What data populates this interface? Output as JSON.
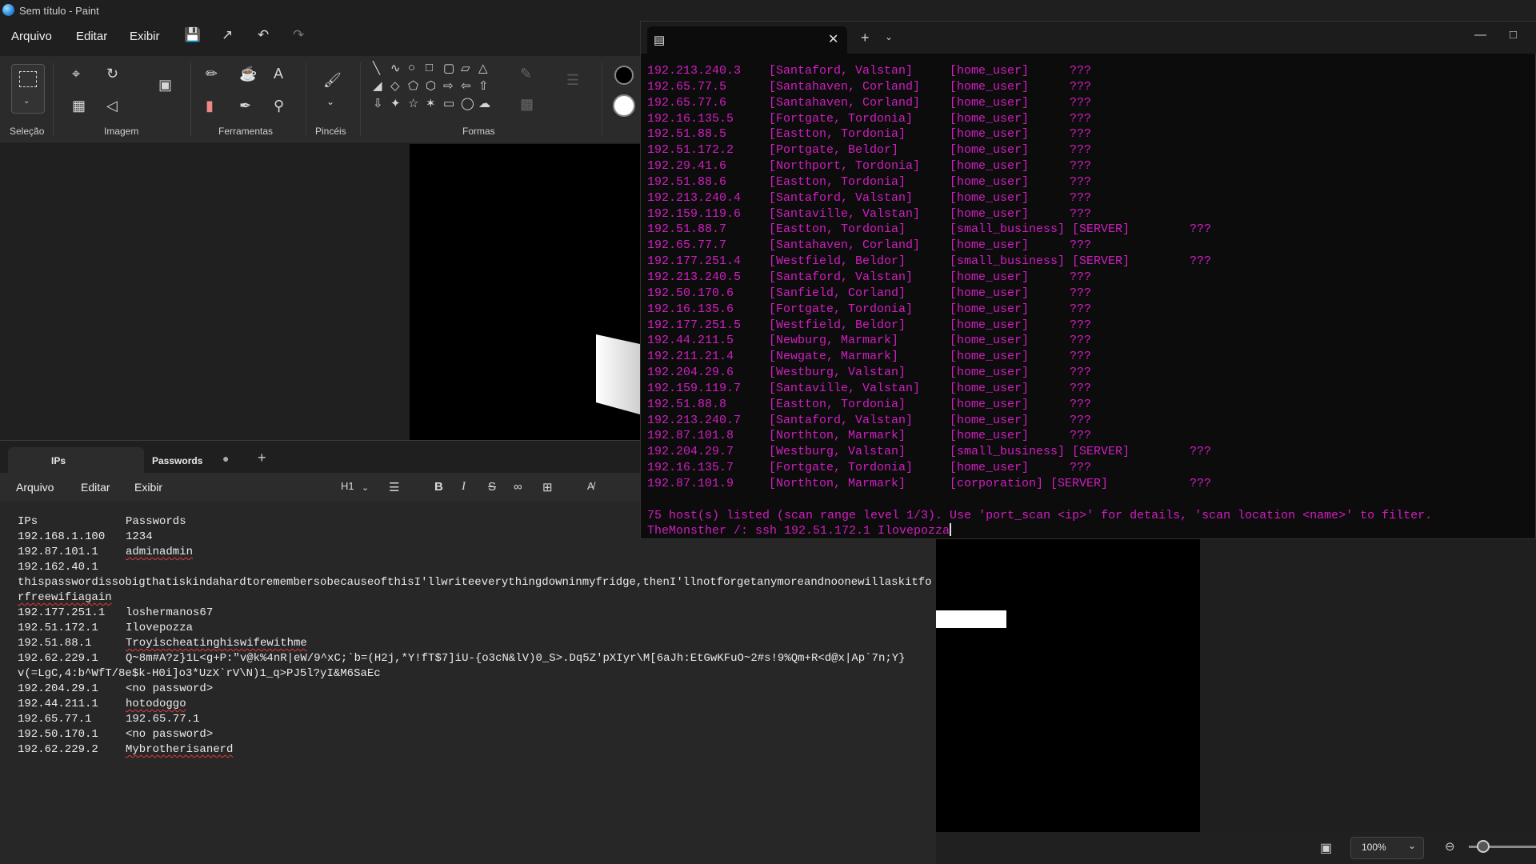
{
  "paint": {
    "window_title": "Sem título - Paint",
    "menu": [
      "Arquivo",
      "Editar",
      "Exibir"
    ],
    "groups": {
      "selection": "Seleção",
      "image": "Imagem",
      "tools": "Ferramentas",
      "brushes": "Pincéis",
      "shapes": "Formas"
    },
    "zoom": "100%"
  },
  "notepad": {
    "tabs": [
      "IPs",
      "Passwords"
    ],
    "menu": [
      "Arquivo",
      "Editar",
      "Exibir"
    ],
    "heading_control": "H1",
    "lines": [
      {
        "ip": "IPs",
        "pw": "Passwords"
      },
      {
        "ip": "192.168.1.100",
        "pw": "1234"
      },
      {
        "ip": "192.87.101.1",
        "pw": "adminadmin"
      },
      {
        "ip": "192.162.40.1",
        "pw": ""
      },
      {
        "ip": "",
        "pw": "thispasswordissobigthatiskindahardtoremembersobecauseofthisI'llwriteeverythingdowninmyfridge,thenI'llnotforgetanymoreandnoonewillaskitfo"
      },
      {
        "ip": "",
        "pw": "rfreewifiagain"
      },
      {
        "ip": "192.177.251.1",
        "pw": "loshermanos67"
      },
      {
        "ip": "192.51.172.1",
        "pw": "Ilovepozza"
      },
      {
        "ip": "192.51.88.1",
        "pw": "Troyischeatinghiswifewithme"
      },
      {
        "ip": "192.62.229.1",
        "pw": "Q~8m#A?z}1L<g+P:\"v@k%4nR|eW/9^xC;`b=(H2j,*Y!fT$7]iU-{o3cN&lV)0_S>.Dq5Z'pXIyr\\M[6aJh:EtGwKFuO~2#s!9%Qm+R<d@x|Ap`7n;Y}"
      },
      {
        "ip": "",
        "pw": "v(=LgC,4:b^WfT/8e$k-H0i]o3*UzX`rV\\N)1_q>PJ5l?yI&M6SaEc"
      },
      {
        "ip": "192.204.29.1",
        "pw": "<no password>"
      },
      {
        "ip": "192.44.211.1",
        "pw": "hotodoggo"
      },
      {
        "ip": "192.65.77.1",
        "pw": "192.65.77.1"
      },
      {
        "ip": "192.50.170.1",
        "pw": "<no password>"
      },
      {
        "ip": "192.62.229.2",
        "pw": "Mybrotherisanerd"
      }
    ]
  },
  "terminal": {
    "rows": [
      {
        "ip": "192.213.240.3",
        "loc": "[Santaford, Valstan]",
        "type": "[home_user]",
        "extra": "???"
      },
      {
        "ip": "192.65.77.5",
        "loc": "[Santahaven, Corland]",
        "type": "[home_user]",
        "extra": "???"
      },
      {
        "ip": "192.65.77.6",
        "loc": "[Santahaven, Corland]",
        "type": "[home_user]",
        "extra": "???"
      },
      {
        "ip": "192.16.135.5",
        "loc": "[Fortgate, Tordonia]",
        "type": "[home_user]",
        "extra": "???"
      },
      {
        "ip": "192.51.88.5",
        "loc": "[Eastton, Tordonia]",
        "type": "[home_user]",
        "extra": "???"
      },
      {
        "ip": "192.51.172.2",
        "loc": "[Portgate, Beldor]",
        "type": "[home_user]",
        "extra": "???"
      },
      {
        "ip": "192.29.41.6",
        "loc": "[Northport, Tordonia]",
        "type": "[home_user]",
        "extra": "???"
      },
      {
        "ip": "192.51.88.6",
        "loc": "[Eastton, Tordonia]",
        "type": "[home_user]",
        "extra": "???"
      },
      {
        "ip": "192.213.240.4",
        "loc": "[Santaford, Valstan]",
        "type": "[home_user]",
        "extra": "???"
      },
      {
        "ip": "192.159.119.6",
        "loc": "[Santaville, Valstan]",
        "type": "[home_user]",
        "extra": "???"
      },
      {
        "ip": "192.51.88.7",
        "loc": "[Eastton, Tordonia]",
        "type": "[small_business] [SERVER]",
        "extra": "???"
      },
      {
        "ip": "192.65.77.7",
        "loc": "[Santahaven, Corland]",
        "type": "[home_user]",
        "extra": "???"
      },
      {
        "ip": "192.177.251.4",
        "loc": "[Westfield, Beldor]",
        "type": "[small_business] [SERVER]",
        "extra": "???"
      },
      {
        "ip": "192.213.240.5",
        "loc": "[Santaford, Valstan]",
        "type": "[home_user]",
        "extra": "???"
      },
      {
        "ip": "192.50.170.6",
        "loc": "[Sanfield, Corland]",
        "type": "[home_user]",
        "extra": "???"
      },
      {
        "ip": "192.16.135.6",
        "loc": "[Fortgate, Tordonia]",
        "type": "[home_user]",
        "extra": "???"
      },
      {
        "ip": "192.177.251.5",
        "loc": "[Westfield, Beldor]",
        "type": "[home_user]",
        "extra": "???"
      },
      {
        "ip": "192.44.211.5",
        "loc": "[Newburg, Marmark]",
        "type": "[home_user]",
        "extra": "???"
      },
      {
        "ip": "192.211.21.4",
        "loc": "[Newgate, Marmark]",
        "type": "[home_user]",
        "extra": "???"
      },
      {
        "ip": "192.204.29.6",
        "loc": "[Westburg, Valstan]",
        "type": "[home_user]",
        "extra": "???"
      },
      {
        "ip": "192.159.119.7",
        "loc": "[Santaville, Valstan]",
        "type": "[home_user]",
        "extra": "???"
      },
      {
        "ip": "192.51.88.8",
        "loc": "[Eastton, Tordonia]",
        "type": "[home_user]",
        "extra": "???"
      },
      {
        "ip": "192.213.240.7",
        "loc": "[Santaford, Valstan]",
        "type": "[home_user]",
        "extra": "???"
      },
      {
        "ip": "192.87.101.8",
        "loc": "[Northton, Marmark]",
        "type": "[home_user]",
        "extra": "???"
      },
      {
        "ip": "192.204.29.7",
        "loc": "[Westburg, Valstan]",
        "type": "[small_business] [SERVER]",
        "extra": "???"
      },
      {
        "ip": "192.16.135.7",
        "loc": "[Fortgate, Tordonia]",
        "type": "[home_user]",
        "extra": "???"
      },
      {
        "ip": "192.87.101.9",
        "loc": "[Northton, Marmark]",
        "type": "[corporation] [SERVER]",
        "extra": "???"
      }
    ],
    "summary": "75 host(s) listed (scan range level 1/3). Use 'port_scan <ip>' for details, 'scan location <name>' to filter.",
    "prompt": "TheMonsther /: ssh 192.51.172.1 Ilovepozza",
    "color": "#d01ec0"
  }
}
